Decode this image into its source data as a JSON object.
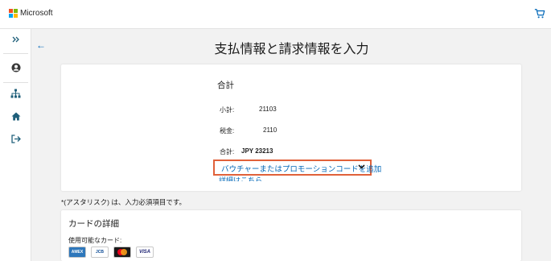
{
  "header": {
    "brand": "Microsoft",
    "icons": [
      "microsoft-logo",
      "cart-icon"
    ],
    "colors": {
      "red": "#f25022",
      "green": "#7fba00",
      "blue": "#00a4ef",
      "yellow": "#ffb900",
      "cart": "#0067b8"
    }
  },
  "sidebar": {
    "items": [
      {
        "icon": "expand-chevrons-icon"
      },
      {
        "icon": "account-icon"
      },
      {
        "icon": "sitemap-icon"
      },
      {
        "icon": "home-icon"
      },
      {
        "icon": "sign-out-icon"
      }
    ]
  },
  "main": {
    "back_icon": "←",
    "title": "支払情報と請求情報を入力"
  },
  "summary": {
    "heading": "合計",
    "subtotal_label": "小計:",
    "subtotal_value": "21103",
    "tax_label": "税金:",
    "tax_value": "2110",
    "total_label": "合計:",
    "total_value": "JPY 23213",
    "voucher_link": "バウチャーまたはプロモーションコードを追加",
    "details_link": "詳細はこちら",
    "highlight_color": "#e0613a"
  },
  "required_note": "*(アスタリスク) は、入力必須項目です。",
  "card_details": {
    "heading": "カードの詳細",
    "accepted_label": "使用可能なカード:",
    "cards": [
      {
        "icon": "amex-card-icon",
        "text": "AMEX"
      },
      {
        "icon": "jcb-card-icon",
        "text": "JCB"
      },
      {
        "icon": "mastercard-icon",
        "text": ""
      },
      {
        "icon": "visa-card-icon",
        "text": "VISA"
      }
    ]
  }
}
